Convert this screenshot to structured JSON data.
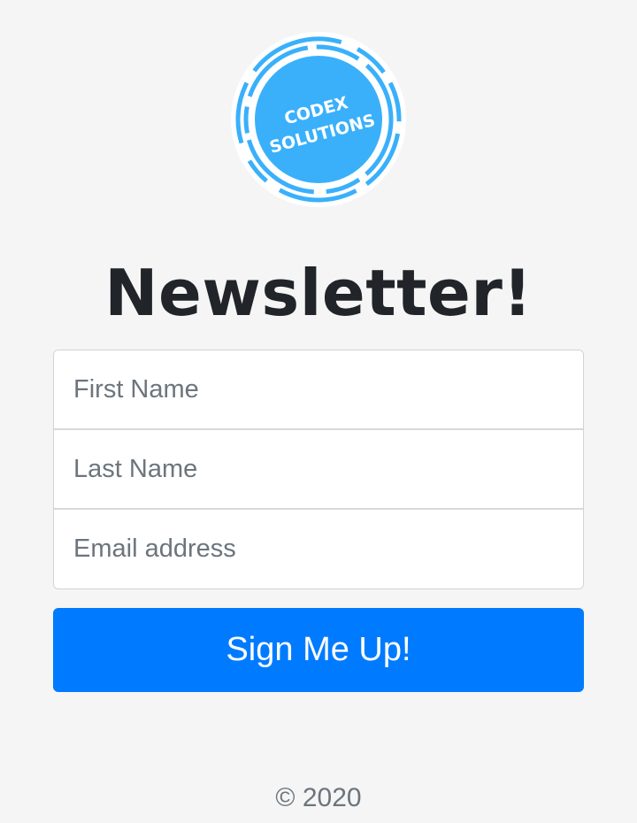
{
  "logo": {
    "line1": "CODEX",
    "line2": "SOLUTIONS",
    "color": "#3ab0fb"
  },
  "page": {
    "title": "Newsletter!"
  },
  "form": {
    "first_name_placeholder": "First Name",
    "last_name_placeholder": "Last Name",
    "email_placeholder": "Email address",
    "submit_label": "Sign Me Up!"
  },
  "footer": {
    "copyright": "© 2020"
  },
  "colors": {
    "background": "#f5f5f5",
    "primary": "#007bff",
    "title": "#212529",
    "muted": "#6c757d"
  }
}
